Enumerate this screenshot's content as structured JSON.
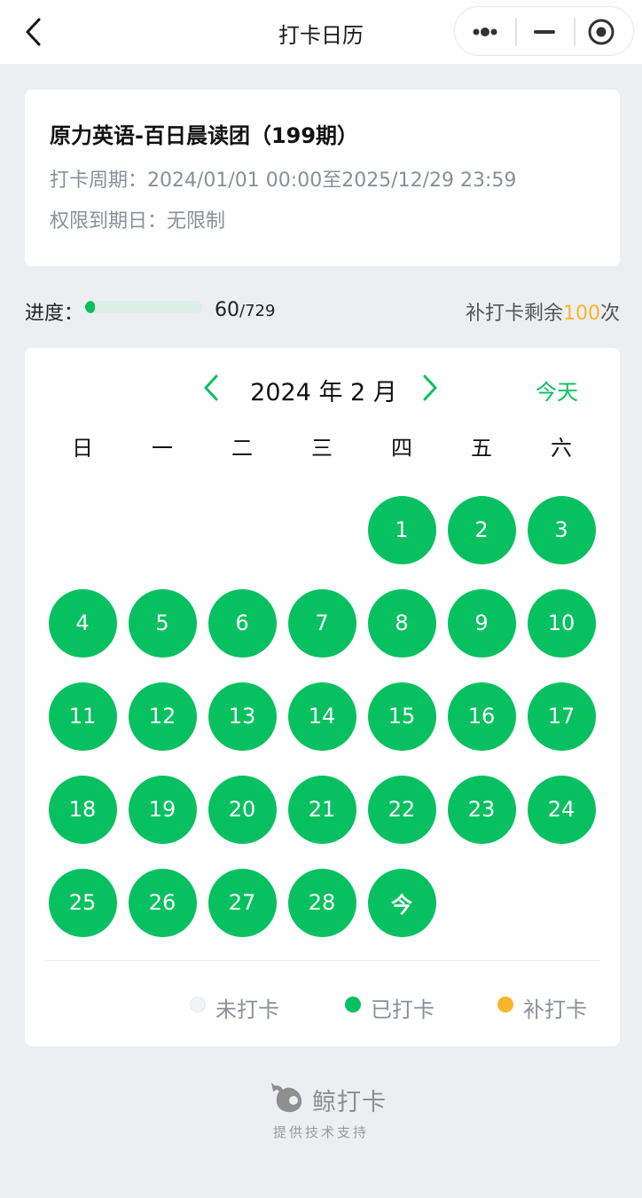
{
  "nav": {
    "title": "打卡日历"
  },
  "course": {
    "title": "原力英语-百日晨读团（199期）",
    "period": "打卡周期：2024/01/01 00:00至2025/12/29 23:59",
    "expire": "权限到期日：无限制"
  },
  "progress": {
    "label": "进度：",
    "done": "60",
    "total": "/729",
    "fraction": 0.082,
    "makeup_prefix": "补打卡剩余",
    "makeup_count": "100",
    "makeup_suffix": "次"
  },
  "calendar": {
    "month_label": "2024 年 2 月",
    "today_label": "今天",
    "weekdays": [
      "日",
      "一",
      "二",
      "三",
      "四",
      "五",
      "六"
    ],
    "days": [
      "1",
      "2",
      "3",
      "4",
      "5",
      "6",
      "7",
      "8",
      "9",
      "10",
      "11",
      "12",
      "13",
      "14",
      "15",
      "16",
      "17",
      "18",
      "19",
      "20",
      "21",
      "22",
      "23",
      "24",
      "25",
      "26",
      "27",
      "28",
      "今"
    ]
  },
  "legend": {
    "unchecked": "未打卡",
    "checked": "已打卡",
    "makeup": "补打卡"
  },
  "colors": {
    "checked": "#07c160",
    "makeup": "#f7b52c",
    "unchecked": "#f2f3f5"
  },
  "footer": {
    "brand": "鲸打卡",
    "sub": "提供技术支持"
  }
}
